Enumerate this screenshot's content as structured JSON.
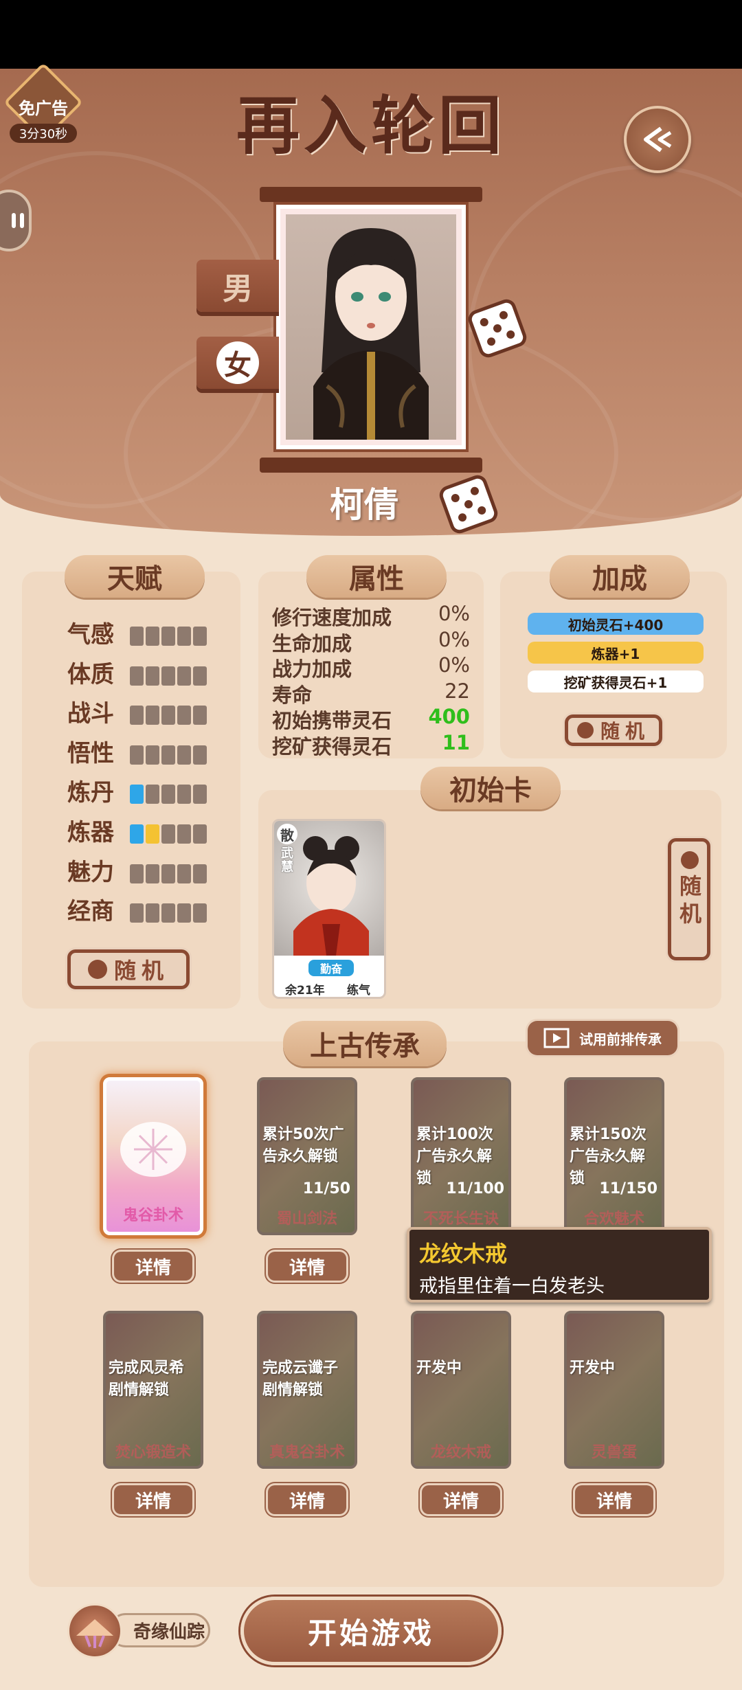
{
  "header": {
    "title": "再入轮回",
    "ad_badge": {
      "label": "免广告",
      "timer": "3分30秒"
    }
  },
  "character": {
    "gender_male": "男",
    "gender_female": "女",
    "selected_gender": "女",
    "name": "柯倩"
  },
  "talent": {
    "title": "天赋",
    "rows": [
      {
        "label": "气感",
        "blue": 0,
        "yellow": 0
      },
      {
        "label": "体质",
        "blue": 0,
        "yellow": 0
      },
      {
        "label": "战斗",
        "blue": 0,
        "yellow": 0
      },
      {
        "label": "悟性",
        "blue": 0,
        "yellow": 0
      },
      {
        "label": "炼丹",
        "blue": 1,
        "yellow": 0
      },
      {
        "label": "炼器",
        "blue": 1,
        "yellow": 1
      },
      {
        "label": "魅力",
        "blue": 0,
        "yellow": 0
      },
      {
        "label": "经商",
        "blue": 0,
        "yellow": 0
      }
    ],
    "random_label": "随机"
  },
  "attributes": {
    "title": "属性",
    "rows": [
      {
        "name": "修行速度加成",
        "value": "0%"
      },
      {
        "name": "生命加成",
        "value": "0%"
      },
      {
        "name": "战力加成",
        "value": "0%"
      },
      {
        "name": "寿命",
        "value": "22"
      },
      {
        "name": "初始携带灵石",
        "value": "400"
      },
      {
        "name": "挖矿获得灵石",
        "value": "11"
      }
    ]
  },
  "bonus": {
    "title": "加成",
    "items": [
      "初始灵石+400",
      "炼器+1",
      "挖矿获得灵石+1"
    ],
    "colors": [
      "#5fb2ee",
      "#f6c549",
      "#ffffff"
    ],
    "random_label": "随机"
  },
  "initial_card": {
    "title": "初始卡",
    "card": {
      "tag": "散",
      "sub_tag": "武慧",
      "trait": "勤奋",
      "age": "余21年",
      "realm": "练气"
    },
    "random_label": "随机"
  },
  "heritage": {
    "title": "上古传承",
    "trial_label": "试用前排传承",
    "cards": [
      {
        "name": "鬼谷卦术",
        "lock": "",
        "progress": ""
      },
      {
        "name": "蜀山剑法",
        "lock": "累计50次广告永久解锁",
        "progress": "11/50"
      },
      {
        "name": "不死长生诀",
        "lock": "累计100次广告永久解锁",
        "progress": "11/100"
      },
      {
        "name": "合欢魅术",
        "lock": "累计150次广告永久解锁",
        "progress": "11/150"
      },
      {
        "name": "焚心锻造术",
        "lock": "完成风灵希剧情解锁",
        "progress": ""
      },
      {
        "name": "真鬼谷卦术",
        "lock": "完成云谶子剧情解锁",
        "progress": ""
      },
      {
        "name": "龙纹木戒",
        "lock": "开发中",
        "progress": ""
      },
      {
        "name": "灵兽蛋",
        "lock": "开发中",
        "progress": ""
      }
    ],
    "detail_label": "详情",
    "tooltip": {
      "title": "龙纹木戒",
      "desc": "戒指里住着一白发老头"
    }
  },
  "footer": {
    "side_label": "奇缘仙踪",
    "start_label": "开始游戏"
  }
}
